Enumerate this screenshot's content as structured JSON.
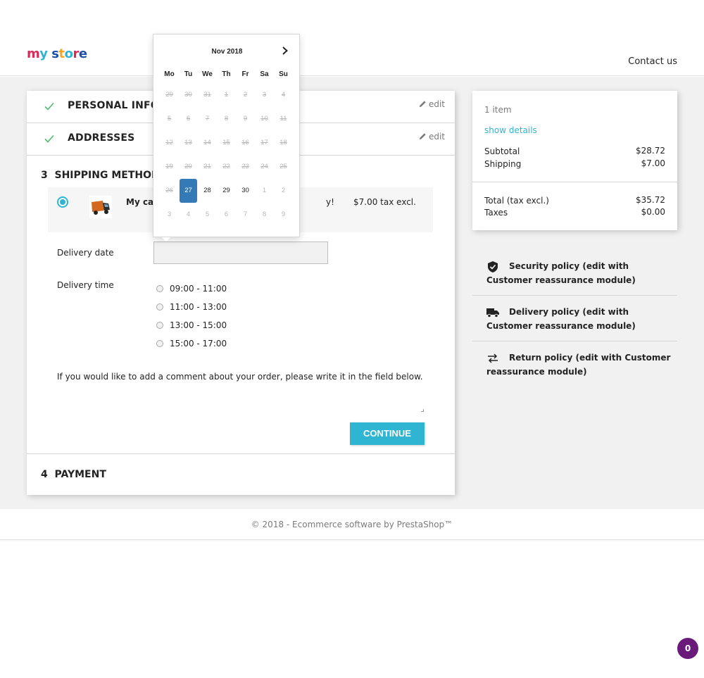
{
  "header": {
    "logo": {
      "m": "m",
      "y": "y",
      "s": "s",
      "t": "t",
      "o": "o",
      "r": "r",
      "e": "e"
    },
    "contact_link": "Contact us"
  },
  "colors": {
    "accent": "#2fb5d2",
    "selected_day": "#337ab7",
    "badge": "#6a1b7a"
  },
  "checkout": {
    "personal_info": {
      "title": "PERSONAL INFORMATION",
      "edit": "edit"
    },
    "addresses": {
      "title": "ADDRESSES",
      "edit": "edit"
    },
    "shipping": {
      "number": "3",
      "title": "SHIPPING METHOD",
      "carrier_name": "My carrier",
      "carrier_tail": "y!",
      "carrier_price": "$7.00 tax excl.",
      "delivery_date_label": "Delivery date",
      "delivery_date_value": "",
      "delivery_time_label": "Delivery time",
      "time_slots": [
        "09:00 - 11:00",
        "11:00 - 13:00",
        "13:00 - 15:00",
        "15:00 - 17:00"
      ],
      "comment_prompt": "If you would like to add a comment about your order, please write it in the field below.",
      "continue_label": "CONTINUE"
    },
    "payment": {
      "number": "4",
      "title": "PAYMENT"
    }
  },
  "summary": {
    "items": "1 item",
    "show_details": "show details",
    "subtotal_label": "Subtotal",
    "subtotal_value": "$28.72",
    "shipping_label": "Shipping",
    "shipping_value": "$7.00",
    "total_label": "Total (tax excl.)",
    "total_value": "$35.72",
    "taxes_label": "Taxes",
    "taxes_value": "$0.00"
  },
  "reassurance": [
    {
      "icon": "shield-icon",
      "text": "Security policy (edit with Customer reassurance module)"
    },
    {
      "icon": "truck-icon",
      "text": "Delivery policy (edit with Customer reassurance module)"
    },
    {
      "icon": "swap-arrows-icon",
      "text": "Return policy (edit with Customer reassurance module)"
    }
  ],
  "footer": {
    "copyright": "© 2018 - Ecommerce software by PrestaShop™"
  },
  "badge": {
    "count": "0"
  },
  "datepicker": {
    "month": "Nov 2018",
    "weekdays": [
      "Mo",
      "Tu",
      "We",
      "Th",
      "Fr",
      "Sa",
      "Su"
    ],
    "weeks": [
      [
        "29",
        "30",
        "31",
        "1",
        "2",
        "3",
        "4"
      ],
      [
        "5",
        "6",
        "7",
        "8",
        "9",
        "10",
        "11"
      ],
      [
        "12",
        "13",
        "14",
        "15",
        "16",
        "17",
        "18"
      ],
      [
        "19",
        "20",
        "21",
        "22",
        "23",
        "24",
        "25"
      ],
      [
        "26",
        "27",
        "28",
        "29",
        "30",
        "1",
        "2"
      ],
      [
        "3",
        "4",
        "5",
        "6",
        "7",
        "8",
        "9"
      ]
    ],
    "selected": "27"
  }
}
